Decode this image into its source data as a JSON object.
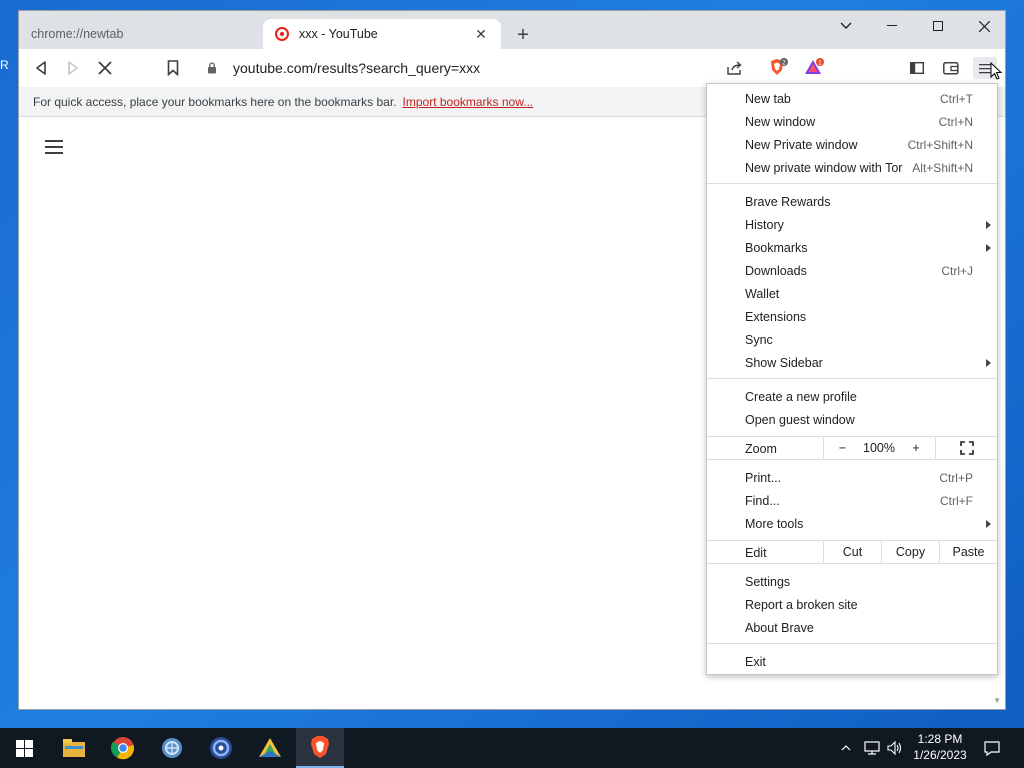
{
  "colors": {
    "import_link": "#c5221f",
    "desktop": "#1a6bd0",
    "taskbar": "#101821"
  },
  "desktop_fragments": [
    "R"
  ],
  "tabs": [
    {
      "title": "chrome://newtab",
      "active": false
    },
    {
      "title": "xxx - YouTube",
      "active": true,
      "favicon": "youtube-icon"
    }
  ],
  "toolbar": {
    "url": "youtube.com/results?search_query=xxx",
    "brave_shields_count": "2",
    "rewards_count": "1"
  },
  "bookmarks_bar": {
    "message": "For quick access, place your bookmarks here on the bookmarks bar.",
    "import_link": "Import bookmarks now..."
  },
  "menu": {
    "new_tab": {
      "label": "New tab",
      "shortcut": "Ctrl+T"
    },
    "new_window": {
      "label": "New window",
      "shortcut": "Ctrl+N"
    },
    "new_private": {
      "label": "New Private window",
      "shortcut": "Ctrl+Shift+N"
    },
    "new_tor": {
      "label": "New private window with Tor",
      "shortcut": "Alt+Shift+N"
    },
    "rewards": {
      "label": "Brave Rewards"
    },
    "history": {
      "label": "History"
    },
    "bookmarks": {
      "label": "Bookmarks"
    },
    "downloads": {
      "label": "Downloads",
      "shortcut": "Ctrl+J"
    },
    "wallet": {
      "label": "Wallet"
    },
    "extensions": {
      "label": "Extensions"
    },
    "sync": {
      "label": "Sync"
    },
    "sidebar": {
      "label": "Show Sidebar"
    },
    "new_profile": {
      "label": "Create a new profile"
    },
    "guest": {
      "label": "Open guest window"
    },
    "zoom": {
      "label": "Zoom",
      "minus": "−",
      "value": "100%",
      "plus": "+"
    },
    "print": {
      "label": "Print...",
      "shortcut": "Ctrl+P"
    },
    "find": {
      "label": "Find...",
      "shortcut": "Ctrl+F"
    },
    "more_tools": {
      "label": "More tools"
    },
    "edit": {
      "label": "Edit",
      "cut": "Cut",
      "copy": "Copy",
      "paste": "Paste"
    },
    "settings": {
      "label": "Settings"
    },
    "report": {
      "label": "Report a broken site"
    },
    "about": {
      "label": "About Brave"
    },
    "exit": {
      "label": "Exit"
    }
  },
  "taskbar": {
    "apps": [
      "file-explorer-icon",
      "chrome-icon",
      "network-icon",
      "media-icon",
      "game-icon",
      "brave-icon"
    ],
    "time": "1:28 PM",
    "date": "1/26/2023"
  }
}
